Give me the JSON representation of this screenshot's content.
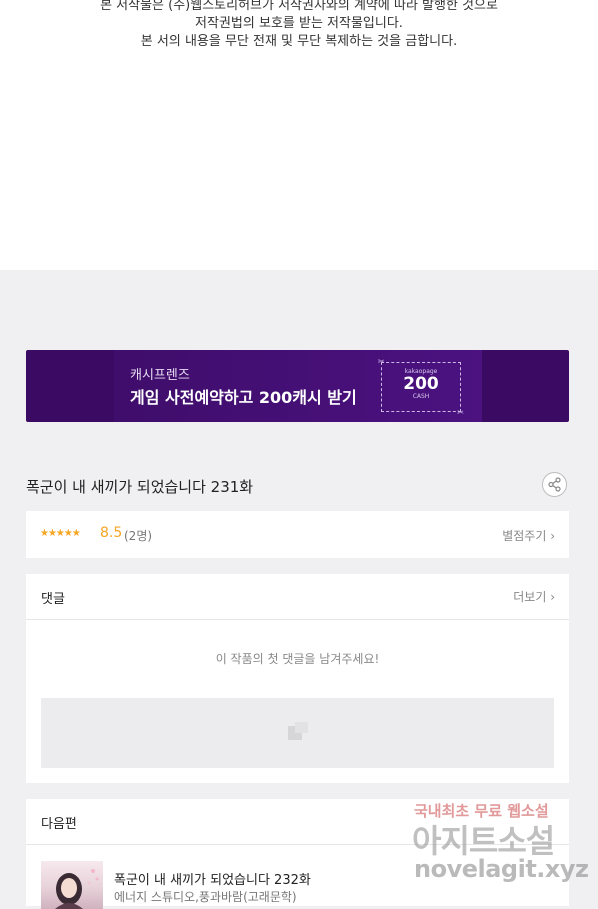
{
  "copyright": {
    "line1": "본 저작물은 (주)웹스토리허브가 저작권자와의 계약에 따라 발행한 것으로",
    "line2": "저작권법의 보호를 받는 저작물입니다.",
    "line3": "본 서의 내용을 무단 전재 및 무단 복제하는 것을 금합니다."
  },
  "banner": {
    "subtitle": "캐시프렌즈",
    "title": "게임 사전예약하고 200캐시 받기",
    "ticket_brand": "kakaopage",
    "ticket_amount": "200",
    "ticket_unit": "CASH",
    "background_color": "#3b0a63"
  },
  "episode": {
    "title": "폭군이 내 새끼가 되었습니다 231화",
    "share_icon": "share-icon"
  },
  "rating": {
    "stars_display": "★★★★★",
    "stars_value": 4.5,
    "score": "8.5",
    "count": "(2명)",
    "rate_link": "별점주기 ›",
    "accent_color": "#f5a623"
  },
  "comments": {
    "heading": "댓글",
    "more_link": "더보기 ›",
    "empty_message": "이 작품의 첫 댓글을 남겨주세요!"
  },
  "next_episode": {
    "heading": "다음편",
    "title": "폭군이 내 새끼가 되었습니다 232화",
    "author": "에너지 스튜디오,풍과바람(고래문학)"
  },
  "watermark": {
    "line1": "국내최초 무료 웹소설",
    "line2": "아지트소설",
    "line3": "novelagit.xyz"
  }
}
